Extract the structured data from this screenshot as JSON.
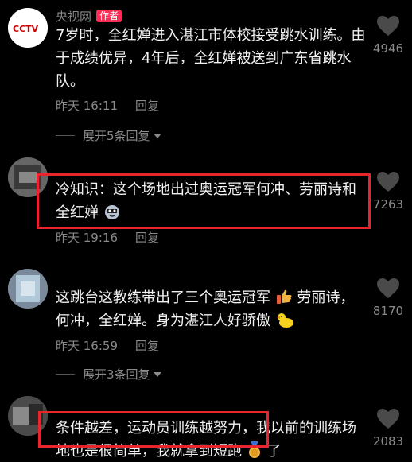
{
  "comments": [
    {
      "author": "央视网",
      "author_tag": "作者",
      "avatar_text": "CCTV",
      "avatar_subtext": "央视网",
      "text": "7岁时，全红婵进入湛江市体校接受跳水训练。由于成绩优异，4年后，全红婵被送到广东省跳水队。",
      "time": "昨天 16:11",
      "reply_label": "回复",
      "likes": "4946",
      "expand_label": "展开5条回复"
    },
    {
      "text": "冷知识：这个场地出过奥运冠军何冲、劳丽诗和全红婵",
      "time": "昨天 19:16",
      "reply_label": "回复",
      "likes": "7263"
    },
    {
      "text": "这跳台这教练带出了三个奥运冠军",
      "text_cont": "劳丽诗，何冲，全红婵。身为湛江人好骄傲",
      "time": "昨天 16:59",
      "reply_label": "回复",
      "likes": "8170",
      "expand_label": "展开3条回复"
    },
    {
      "text": "条件越差，运动员训练越努力，我以前的训练场地也是很简单，我就拿到短跑",
      "text_end": "了",
      "likes": "2083"
    }
  ],
  "colors": {
    "background": "#000000",
    "highlight_box": "#e8242c",
    "author_tag": "#fe2c55",
    "meta_text": "#8a8a8a"
  },
  "icons": [
    "heart-icon",
    "cat-emoji",
    "thumbs-up-emoji",
    "duck-emoji",
    "medal-emoji",
    "caret-down-icon"
  ]
}
